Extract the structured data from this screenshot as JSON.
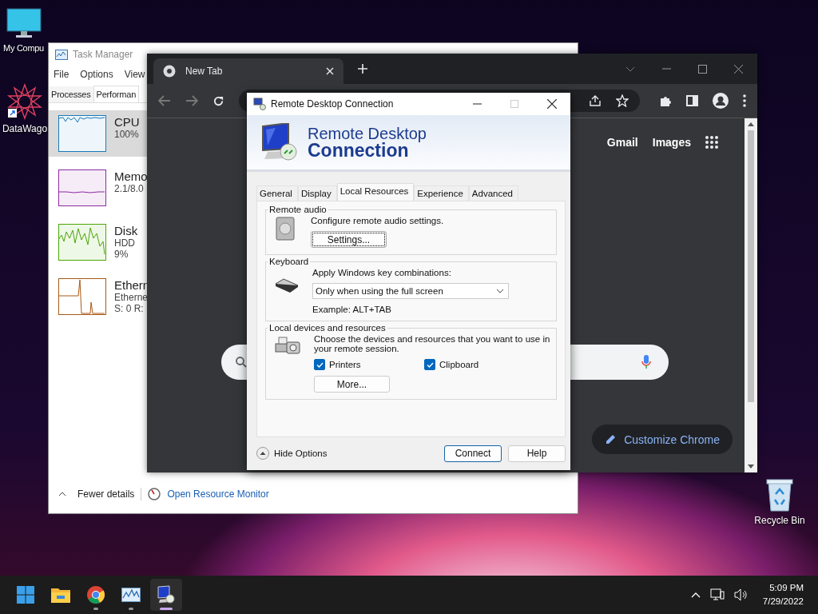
{
  "desktop_icons": [
    {
      "kind": "computer",
      "label": "My Compu"
    },
    {
      "kind": "shortcut",
      "label": "DataWago"
    },
    {
      "kind": "recycle",
      "label": "Recycle Bin"
    }
  ],
  "task_manager": {
    "title": "Task Manager",
    "menu": [
      "File",
      "Options",
      "View"
    ],
    "tabs": [
      {
        "label": "Processes",
        "selected": false
      },
      {
        "label": "Performan",
        "selected": true
      }
    ],
    "resources": [
      {
        "kind": "cpu",
        "name": "CPU",
        "lines": [
          "100%"
        ],
        "selected": true
      },
      {
        "kind": "memory",
        "name": "Memo",
        "lines": [
          "2.1/8.0"
        ],
        "selected": false
      },
      {
        "kind": "disk",
        "name": "Disk",
        "lines": [
          "HDD",
          "9%"
        ],
        "selected": false
      },
      {
        "kind": "ethernet",
        "name": "Ethern",
        "lines": [
          "Etherne",
          "S: 0 R:"
        ],
        "selected": false
      }
    ],
    "fewer_details": "Fewer details",
    "resource_monitor": "Open Resource Monitor"
  },
  "chrome": {
    "tab": "New Tab",
    "links": [
      "Gmail",
      "Images"
    ],
    "customize": "Customize Chrome"
  },
  "rdp": {
    "title": "Remote Desktop Connection",
    "banner": [
      "Remote Desktop",
      "Connection"
    ],
    "tabs": [
      {
        "label": "General",
        "selected": false
      },
      {
        "label": "Display",
        "selected": false
      },
      {
        "label": "Local Resources",
        "selected": true
      },
      {
        "label": "Experience",
        "selected": false
      },
      {
        "label": "Advanced",
        "selected": false
      }
    ],
    "audio": {
      "title": "Remote audio",
      "text": "Configure remote audio settings.",
      "button": "Settings..."
    },
    "keyboard": {
      "title": "Keyboard",
      "label": "Apply Windows key combinations:",
      "value": "Only when using the full screen",
      "example": "Example: ALT+TAB"
    },
    "devices": {
      "title": "Local devices and resources",
      "text": "Choose the devices and resources that you want to use in your remote session.",
      "checks": [
        {
          "label": "Printers",
          "checked": true
        },
        {
          "label": "Clipboard",
          "checked": true
        }
      ],
      "button": "More..."
    },
    "hide_options": "Hide Options",
    "buttons": [
      "Connect",
      "Help"
    ]
  },
  "taskbar": {
    "apps": [
      {
        "kind": "start",
        "running": false,
        "active": false
      },
      {
        "kind": "folder",
        "running": false,
        "active": false
      },
      {
        "kind": "browser",
        "running": true,
        "active": false
      },
      {
        "kind": "monitor",
        "running": true,
        "active": false
      },
      {
        "kind": "remote",
        "running": true,
        "active": true
      }
    ],
    "time": "5:09 PM",
    "date": "7/29/2022"
  }
}
